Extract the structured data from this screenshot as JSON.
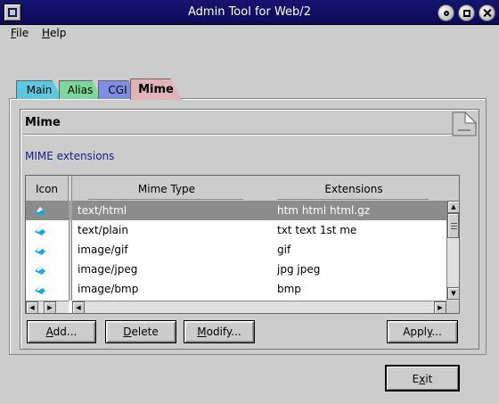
{
  "window": {
    "title": "Admin Tool for Web/2"
  },
  "menu": {
    "items": [
      {
        "label": "File",
        "mnemonic": "F",
        "rest": "ile"
      },
      {
        "label": "Help",
        "mnemonic": "H",
        "rest": "elp"
      }
    ]
  },
  "tabs": [
    {
      "label": "Main",
      "color": "#5bc8e0"
    },
    {
      "label": "Alias",
      "color": "#7cd89a"
    },
    {
      "label": "CGI",
      "color": "#7d8ee3"
    },
    {
      "label": "Mime",
      "color": "#dfb3b8",
      "active": true
    }
  ],
  "page": {
    "title": "Mime",
    "section_label": "MIME extensions"
  },
  "table": {
    "columns": [
      "Icon",
      "Mime Type",
      "Extensions"
    ],
    "rows": [
      {
        "icon": "mime-file-icon",
        "mime_type": "text/html",
        "extensions": "htm html html.gz",
        "selected": true
      },
      {
        "icon": "mime-file-icon",
        "mime_type": "text/plain",
        "extensions": "txt text 1st me",
        "selected": false
      },
      {
        "icon": "mime-file-icon",
        "mime_type": "image/gif",
        "extensions": "gif",
        "selected": false
      },
      {
        "icon": "mime-file-icon",
        "mime_type": "image/jpeg",
        "extensions": "jpg jpeg",
        "selected": false
      },
      {
        "icon": "mime-file-icon",
        "mime_type": "image/bmp",
        "extensions": "bmp",
        "selected": false
      }
    ]
  },
  "buttons": {
    "add": {
      "mnemonic": "A",
      "rest": "dd..."
    },
    "delete": {
      "mnemonic": "D",
      "rest": "elete"
    },
    "modify": {
      "mnemonic": "M",
      "rest": "odify..."
    },
    "apply": {
      "pre": "Appl",
      "mnemonic": "y",
      "rest": "..."
    },
    "exit": {
      "pre": "E",
      "mnemonic": "x",
      "rest": "it"
    }
  },
  "colors": {
    "titlebar": "#0b0a5a",
    "selected_row": "#8c8c8c",
    "section_label": "#1a1a8c"
  }
}
